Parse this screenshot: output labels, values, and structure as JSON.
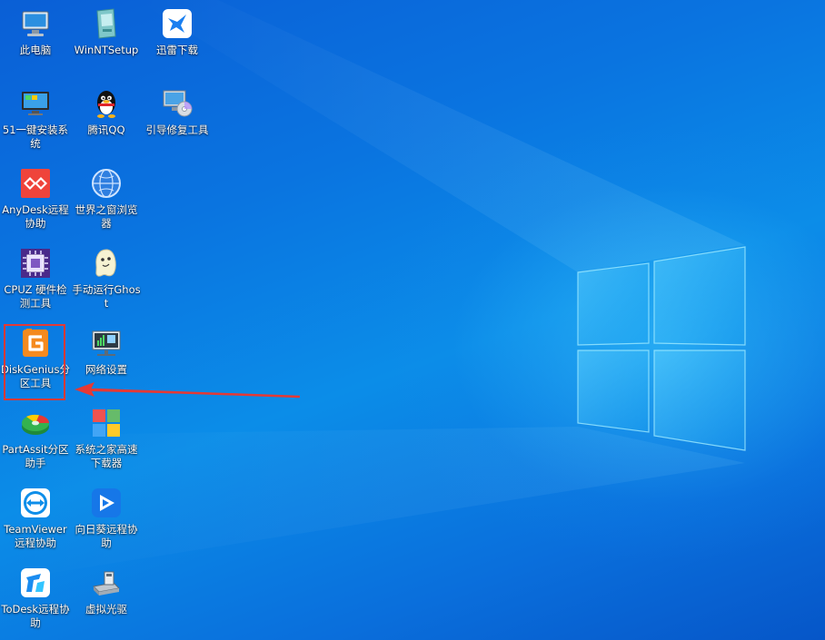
{
  "desktop": {
    "icons": [
      {
        "name": "this-pc",
        "label": "此电脑",
        "icon": "computer-icon"
      },
      {
        "name": "winntsetup",
        "label": "WinNTSetup",
        "icon": "installer-icon"
      },
      {
        "name": "xunlei",
        "label": "迅雷下载",
        "icon": "thunder-bird-icon"
      },
      {
        "name": "51-install",
        "label": "51一键安装系统",
        "icon": "monitor-install-icon"
      },
      {
        "name": "qq",
        "label": "腾讯QQ",
        "icon": "qq-penguin-icon"
      },
      {
        "name": "boot-repair",
        "label": "引导修复工具",
        "icon": "boot-repair-icon"
      },
      {
        "name": "anydesk",
        "label": "AnyDesk远程协助",
        "icon": "anydesk-icon"
      },
      {
        "name": "theworld-browser",
        "label": "世界之窗浏览器",
        "icon": "globe-icon"
      },
      {
        "name": "cpuz",
        "label": "CPUZ 硬件检测工具",
        "icon": "cpu-chip-icon"
      },
      {
        "name": "ghost",
        "label": "手动运行Ghost",
        "icon": "ghost-icon"
      },
      {
        "name": "diskgenius",
        "label": "DiskGenius分区工具",
        "icon": "diskgenius-icon"
      },
      {
        "name": "network-settings",
        "label": "网络设置",
        "icon": "network-monitor-icon"
      },
      {
        "name": "partassist",
        "label": "PartAssit分区助手",
        "icon": "partition-disk-icon"
      },
      {
        "name": "xitongzhijia",
        "label": "系统之家高速下载器",
        "icon": "windows-tiles-icon"
      },
      {
        "name": "teamviewer",
        "label": "TeamViewer远程协助",
        "icon": "teamviewer-icon"
      },
      {
        "name": "sunlogin",
        "label": "向日葵远程协助",
        "icon": "sunlogin-icon"
      },
      {
        "name": "todesk",
        "label": "ToDesk远程协助",
        "icon": "todesk-icon"
      },
      {
        "name": "virtual-drive",
        "label": "虚拟光驱",
        "icon": "virtual-drive-icon"
      }
    ]
  },
  "colors": {
    "highlight": "#e53935",
    "wallpaper_base": "#0a74e0",
    "wallpaper_glow": "#7fe0ff"
  }
}
